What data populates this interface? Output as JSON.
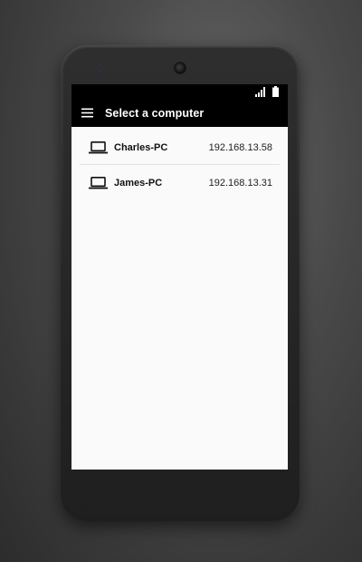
{
  "app_bar": {
    "title": "Select a computer",
    "menu_icon": "hamburger-menu-icon"
  },
  "status_bar": {
    "signal_icon": "cell-signal-icon",
    "battery_icon": "battery-full-icon"
  },
  "computers": [
    {
      "name": "Charles-PC",
      "ip": "192.168.13.58",
      "icon": "laptop-icon"
    },
    {
      "name": "James-PC",
      "ip": "192.168.13.31",
      "icon": "laptop-icon"
    }
  ],
  "colors": {
    "app_bar_background": "#000000",
    "screen_background": "#fafafa",
    "title_text": "#ffffff",
    "divider": "#e3e3e3"
  }
}
